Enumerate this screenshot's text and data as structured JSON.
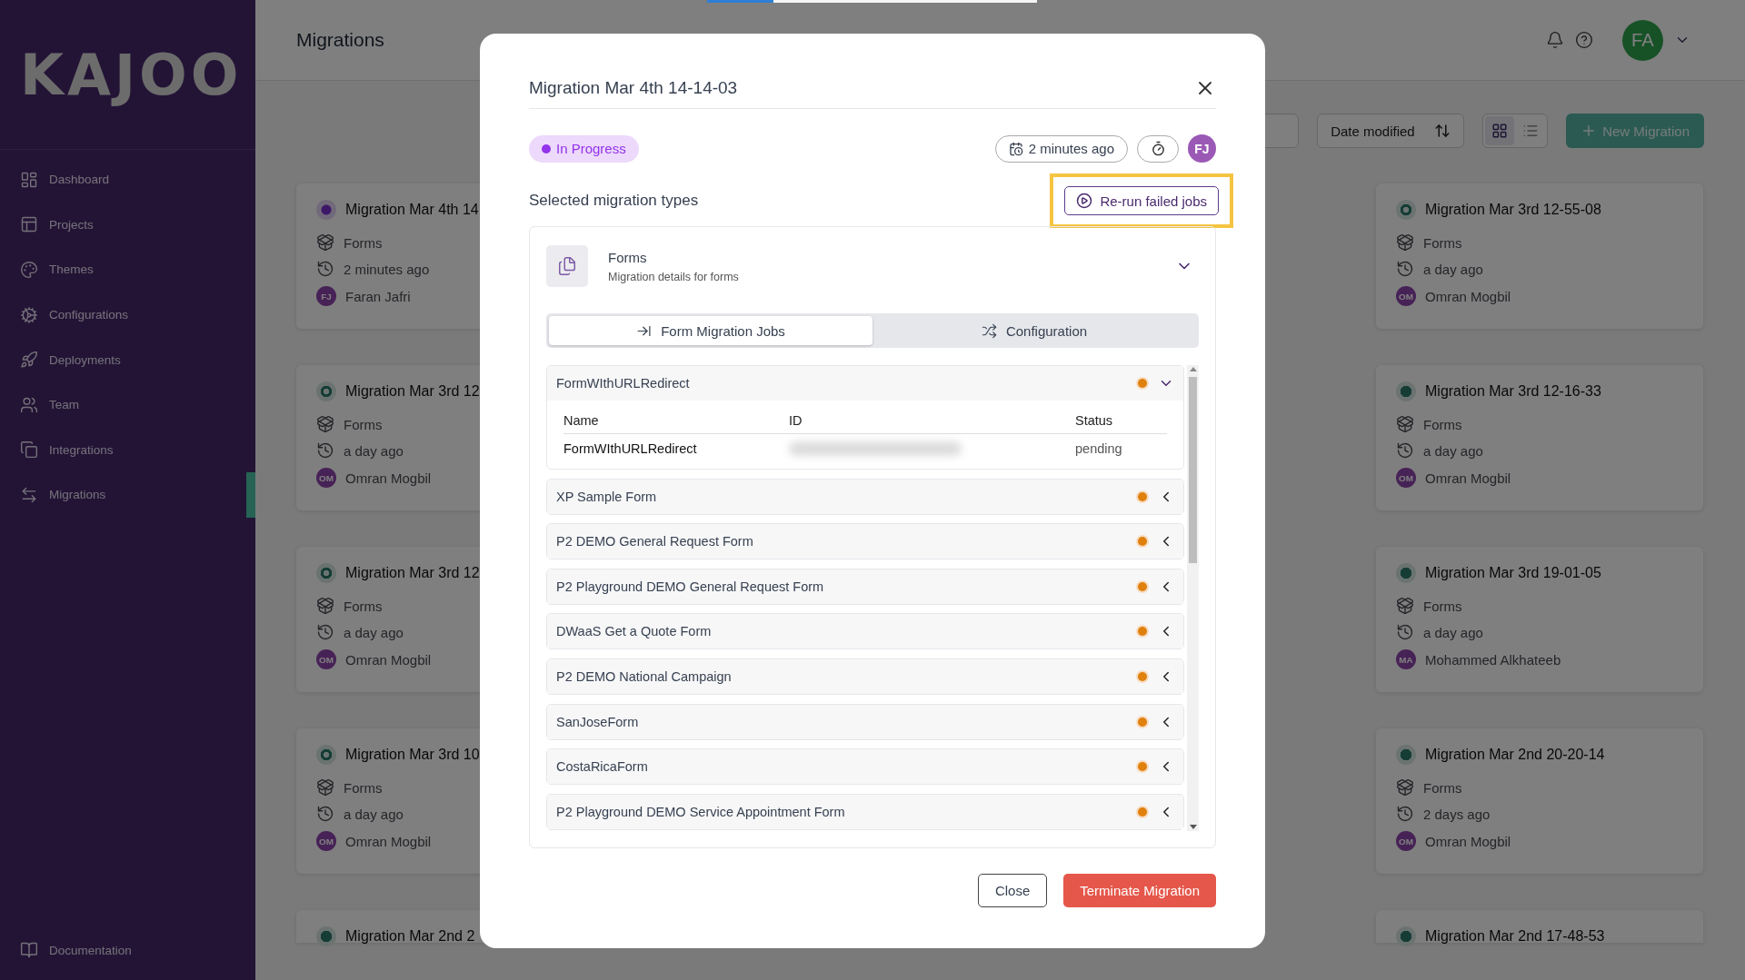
{
  "top_progress": {
    "level": 0.2
  },
  "sidebar": {
    "logo": "KAJOO",
    "items": [
      {
        "label": "Dashboard",
        "selected": false
      },
      {
        "label": "Projects",
        "selected": false
      },
      {
        "label": "Themes",
        "selected": false
      },
      {
        "label": "Configurations",
        "selected": false
      },
      {
        "label": "Deployments",
        "selected": false
      },
      {
        "label": "Team",
        "selected": false
      },
      {
        "label": "Integrations",
        "selected": false
      },
      {
        "label": "Migrations",
        "selected": true
      }
    ],
    "footer_item": {
      "label": "Documentation"
    }
  },
  "header": {
    "title": "Migrations",
    "user_initials": "FA"
  },
  "toolbar": {
    "sort_label": "Date modified",
    "view_options": [
      {
        "kind": "grid",
        "selected": true
      },
      {
        "kind": "list",
        "selected": false
      }
    ],
    "new_button": "New Migration"
  },
  "cards": {
    "column_1": [
      {
        "title": "Migration Mar 4th 14",
        "kind": "in_progress",
        "type": "Forms",
        "time": "2 minutes ago",
        "initials": "FJ",
        "author": "Faran Jafri"
      },
      {
        "title": "Migration Mar 3rd 12",
        "kind": "partial",
        "type": "Forms",
        "time": "a day ago",
        "initials": "OM",
        "author": "Omran Mogbil"
      },
      {
        "title": "Migration Mar 3rd 12",
        "kind": "partial",
        "type": "Forms",
        "time": "a day ago",
        "initials": "OM",
        "author": "Omran Mogbil"
      },
      {
        "title": "Migration Mar 3rd 10",
        "kind": "partial",
        "type": "Forms",
        "time": "a day ago",
        "initials": "OM",
        "author": "Omran Mogbil"
      },
      {
        "title": "Migration Mar 2nd 2",
        "kind": "completed"
      }
    ],
    "column_4": [
      {
        "title": "Migration Mar 3rd 12-55-08",
        "kind": "partial",
        "type": "Forms",
        "time": "a day ago",
        "initials": "OM",
        "author": "Omran Mogbil"
      },
      {
        "title": "Migration Mar 3rd 12-16-33",
        "kind": "completed",
        "type": "Forms",
        "time": "a day ago",
        "initials": "OM",
        "author": "Omran Mogbil"
      },
      {
        "title": "Migration Mar 3rd 19-01-05",
        "kind": "completed",
        "type": "Forms",
        "time": "a day ago",
        "initials": "MA",
        "author": "Mohammed Alkhateeb"
      },
      {
        "title": "Migration Mar 2nd 20-20-14",
        "kind": "completed",
        "type": "Forms",
        "time": "2 days ago",
        "initials": "OM",
        "author": "Omran Mogbil"
      },
      {
        "title": "Migration Mar 2nd 17-48-53",
        "kind": "completed"
      }
    ]
  },
  "modal": {
    "title": "Migration Mar 4th 14-14-03",
    "status": "In Progress",
    "created": "2 minutes ago",
    "owner_initials": "FJ",
    "section_title": "Selected migration types",
    "rerun_button": "Re-run failed jobs",
    "highlighted": true,
    "migration_type": {
      "name": "Forms",
      "description": "Migration details for forms",
      "expanded": true
    },
    "tabs": [
      {
        "label": "Form Migration Jobs",
        "selected": true
      },
      {
        "label": "Configuration",
        "selected": false
      }
    ],
    "jobs": [
      {
        "name": "FormWIthURLRedirect",
        "expanded": true,
        "table": {
          "columns": [
            "Name",
            "ID",
            "Status"
          ],
          "rows": [
            {
              "name": "FormWIthURLRedirect",
              "status": "pending"
            }
          ]
        }
      },
      {
        "name": "XP Sample Form",
        "expanded": false
      },
      {
        "name": "P2 DEMO General Request Form",
        "expanded": false
      },
      {
        "name": "P2 Playground DEMO General Request Form",
        "expanded": false
      },
      {
        "name": "DWaaS Get a Quote Form",
        "expanded": false
      },
      {
        "name": "P2 DEMO National Campaign",
        "expanded": false
      },
      {
        "name": "SanJoseForm",
        "expanded": false
      },
      {
        "name": "CostaRicaForm",
        "expanded": false
      },
      {
        "name": "P2 Playground DEMO Service Appointment Form",
        "expanded": false
      }
    ],
    "buttons": {
      "close": "Close",
      "terminate": "Terminate Migration"
    }
  }
}
